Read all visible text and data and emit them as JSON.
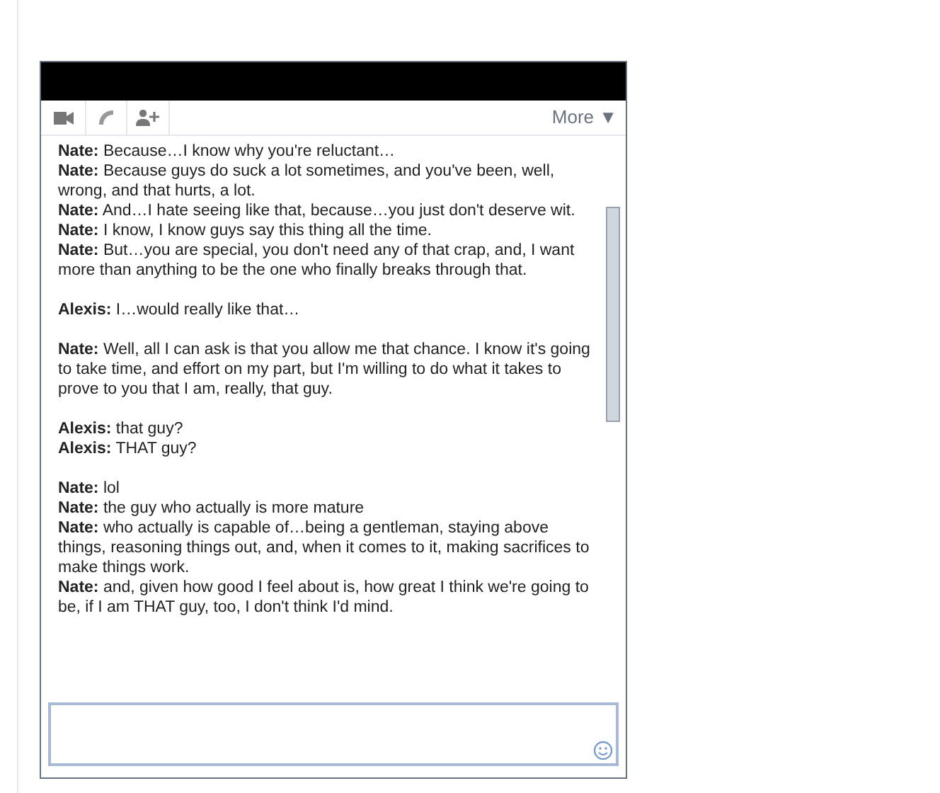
{
  "toolbar": {
    "more": "More ▼"
  },
  "groups": [
    {
      "messages": [
        "**Nate:** Because…I know why you're reluctant…",
        "**Nate:** Because guys do suck a lot sometimes, and you've been, well, wrong, and that hurts, a lot.",
        "**Nate:** And…I hate seeing like that, because…you just don't deserve wit.",
        "**Nate:** I know, I know guys say this thing all the time.",
        "**Nate:** But…you are special, you don't need any of that crap, and, I want more than anything to be the one who finally breaks through that."
      ]
    },
    {
      "messages": [
        "**Alexis:** I…would really like that…"
      ]
    },
    {
      "messages": [
        "**Nate:** Well, all I can ask is that you allow me that chance. I know it's going to take time, and effort on my part, but I'm willing to do what it takes to prove to you that I am, really, that guy."
      ]
    },
    {
      "messages": [
        "**Alexis:** that guy?",
        "**Alexis:** THAT guy?"
      ]
    },
    {
      "messages": [
        "**Nate:** lol",
        "**Nate:** the guy who actually is more mature",
        "**Nate:** who actually is capable of…being a gentleman, staying above things, reasoning things out, and, when it comes to it, making sacrifices to make things work.",
        "**Nate:** and, given how good I feel about is, how great I think we're going to be, if I am THAT guy, too, I don't think I'd mind."
      ]
    }
  ]
}
